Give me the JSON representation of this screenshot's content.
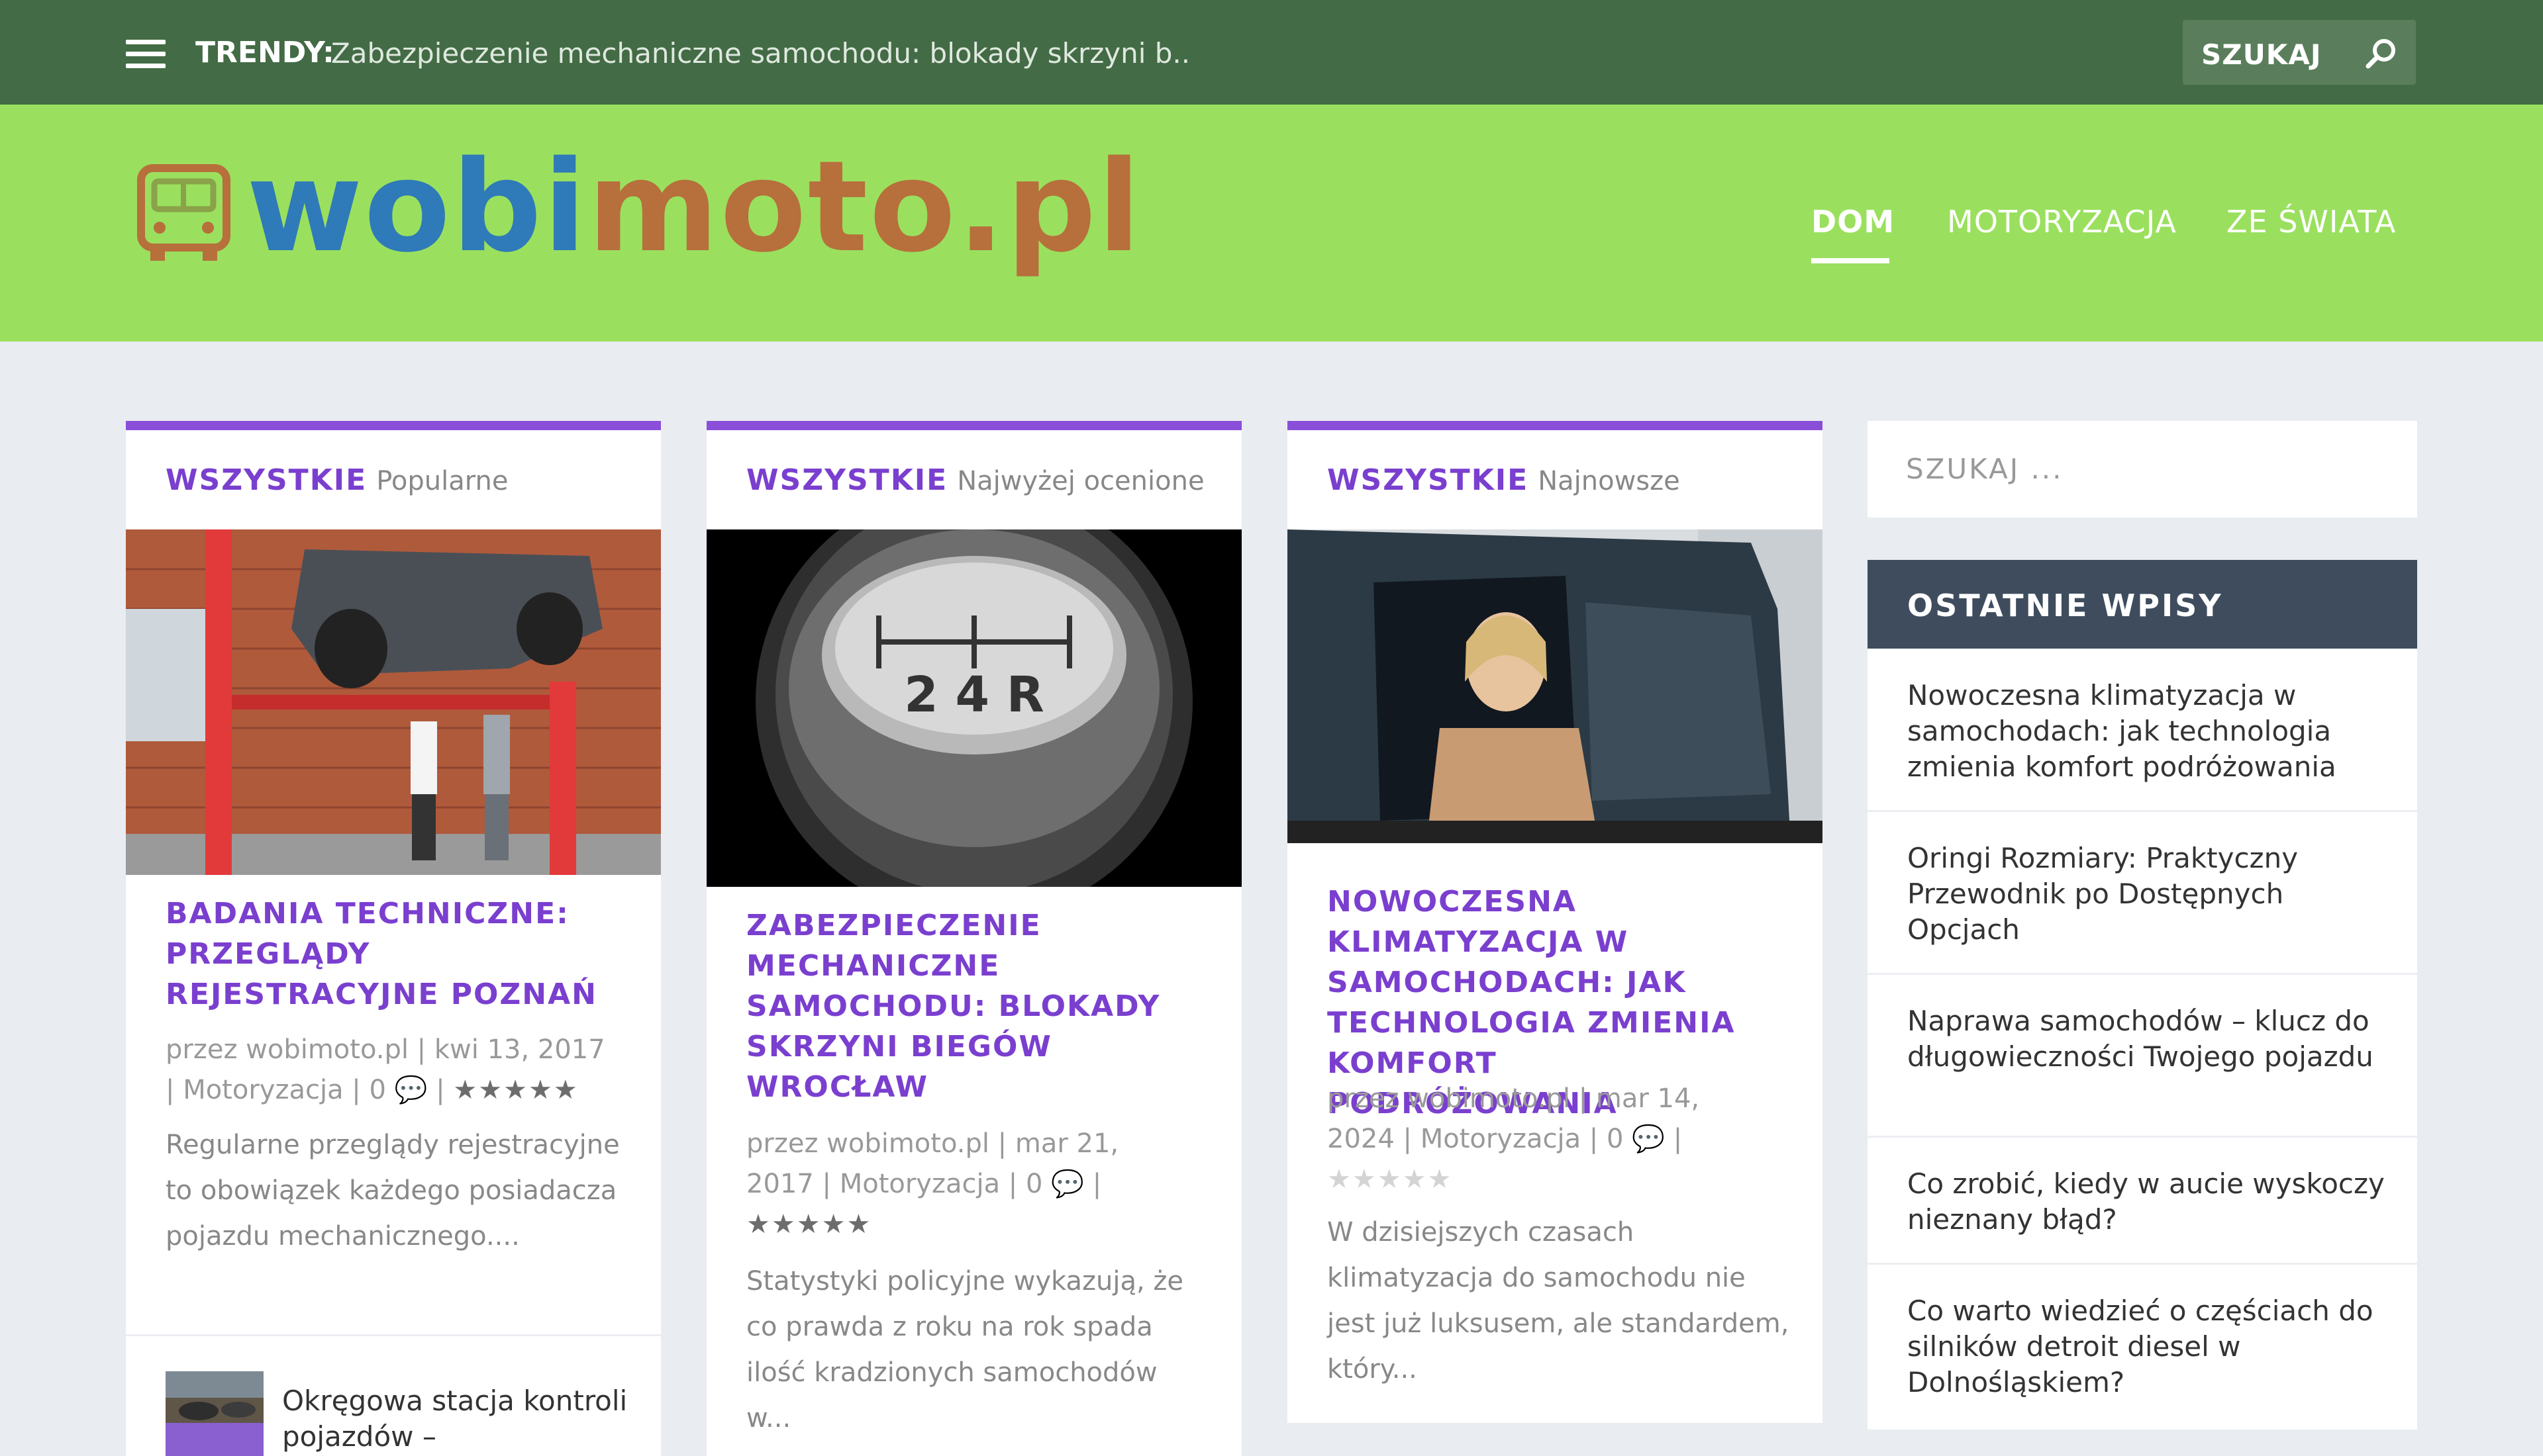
{
  "topbar": {
    "trend_label": "TRENDY:",
    "trend_text": "Zabezpieczenie mechaniczne samochodu: blokady skrzyni b...",
    "search_label": "SZUKAJ"
  },
  "logo": {
    "part1": "wobi",
    "part2": "moto.pl"
  },
  "nav": {
    "items": [
      "DOM",
      "MOTORYZACJA",
      "ZE ŚWIATA"
    ]
  },
  "cards": [
    {
      "tab_label": "WSZYSTKIE",
      "tab_sub": "Popularne",
      "title": "BADANIA TECHNICZNE: PRZEGLĄDY REJESTRACYJNE POZNAŃ",
      "meta_line1": "przez wobimoto.pl | kwi 13, 2017",
      "meta_line2_pre": "| Motoryzacja | 0",
      "meta_line2_post": "|",
      "stars": "★★★★★",
      "excerpt": "Regularne przeglądy rejestracyjne to obowiązek każdego posiadacza pojazdu mechanicznego...."
    },
    {
      "tab_label": "WSZYSTKIE",
      "tab_sub": "Najwyżej ocenione",
      "title": "ZABEZPIECZENIE MECHANICZNE SAMOCHODU: BLOKADY SKRZYNI BIEGÓW WROCŁAW",
      "meta_line1": "przez wobimoto.pl | mar 21,",
      "meta_line2_pre": "2017 | Motoryzacja | 0",
      "meta_line2_post": "|",
      "stars": "★★★★★",
      "excerpt": "Statystyki policyjne wykazują, że co prawda z roku na rok spada ilość kradzionych samochodów w..."
    },
    {
      "tab_label": "WSZYSTKIE",
      "tab_sub": "Najnowsze",
      "title": "NOWOCZESNA KLIMATYZACJA W SAMOCHODACH: JAK TECHNOLOGIA ZMIENIA KOMFORT PODRÓŻOWANIA",
      "meta_line1": "przez wobimoto.pl | mar 14,",
      "meta_line2_pre": "2024 | Motoryzacja | 0",
      "meta_line2_post": "|",
      "stars": "★★★★★",
      "excerpt": "W dzisiejszych czasach klimatyzacja do samochodu nie jest już luksusem, ale standardem, który..."
    }
  ],
  "gear_knob_text": "2 4 R",
  "mini_post": {
    "title": "Okręgowa stacja kontroli pojazdów –"
  },
  "sidebar": {
    "search_placeholder": "SZUKAJ ...",
    "recent_title": "OSTATNIE WPISY",
    "recent": [
      "Nowoczesna klimatyzacja w samochodach: jak technologia zmienia komfort podróżowania",
      "Oringi Rozmiary: Praktyczny Przewodnik po Dostępnych Opcjach",
      "Naprawa samochodów – klucz do długowieczności Twojego pojazdu",
      "Co zrobić, kiedy w aucie wyskoczy nieznany błąd?",
      "Co warto wiedzieć o częściach do silników detroit diesel w Dolnośląskiem?"
    ]
  },
  "colors": {
    "topbar": "#436b45",
    "header": "#9ae05e",
    "accent": "#7a3fcf",
    "logo_blue": "#2f7ab8",
    "logo_brown": "#b76f3c",
    "sidebar_head": "#3e4c5e"
  }
}
